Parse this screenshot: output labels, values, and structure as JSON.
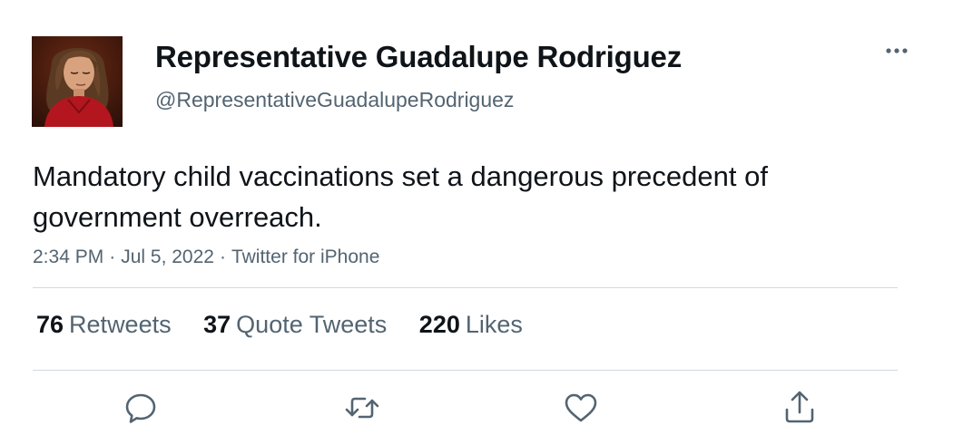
{
  "tweet": {
    "author": {
      "display_name": "Representative Guadalupe Rodriguez",
      "handle": "@RepresentativeGuadalupeRodriguez",
      "avatar_icon": "profile-photo"
    },
    "text": "Mandatory child vaccinations set a dangerous precedent of government overreach.",
    "meta": {
      "time": "2:34 PM",
      "separator": "·",
      "date": "Jul 5, 2022",
      "source": "Twitter for iPhone"
    },
    "stats": {
      "retweets": {
        "count": "76",
        "label": "Retweets"
      },
      "quote_tweets": {
        "count": "37",
        "label": "Quote Tweets"
      },
      "likes": {
        "count": "220",
        "label": "Likes"
      }
    },
    "actions": [
      {
        "name": "reply",
        "icon": "reply-icon"
      },
      {
        "name": "retweet",
        "icon": "retweet-icon"
      },
      {
        "name": "like",
        "icon": "heart-icon"
      },
      {
        "name": "share",
        "icon": "share-icon"
      }
    ],
    "colors": {
      "text_primary": "#0f1419",
      "text_secondary": "#536471",
      "divider": "#cfd9de",
      "icon": "#536471"
    }
  }
}
